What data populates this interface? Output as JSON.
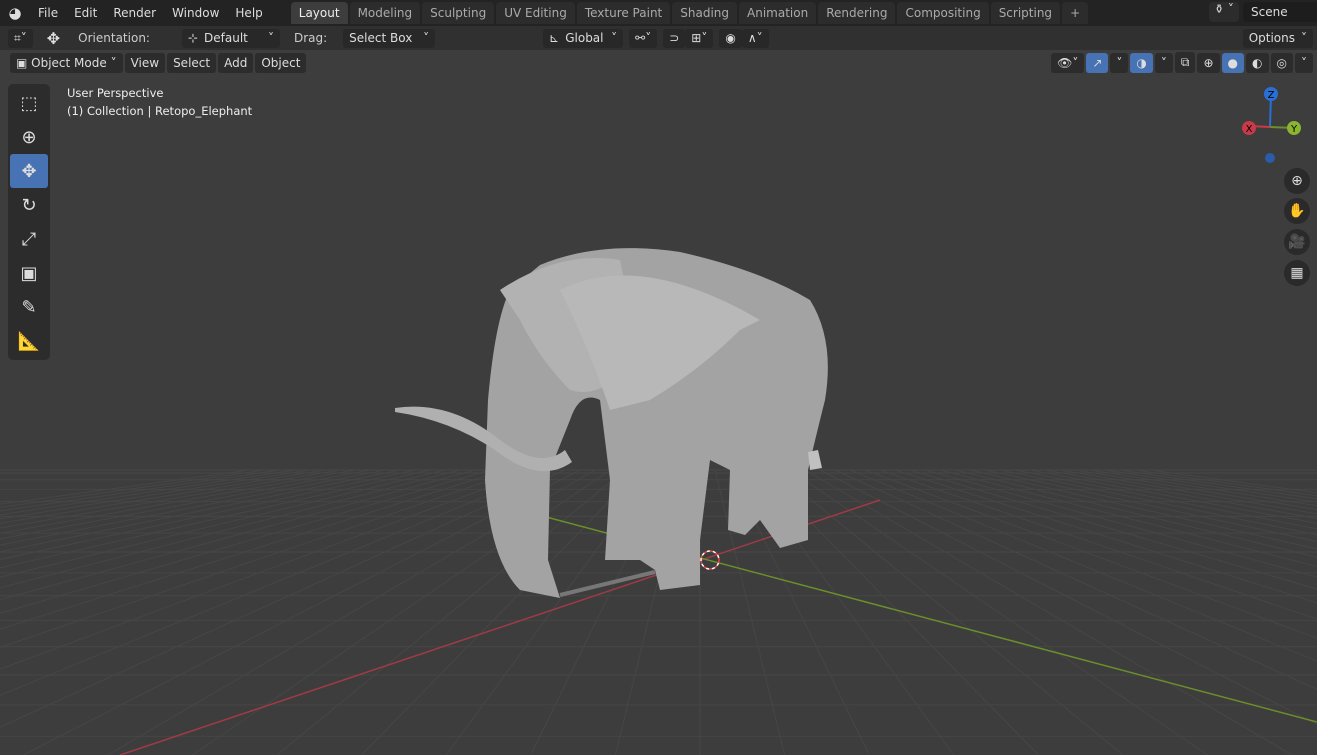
{
  "menu": [
    "File",
    "Edit",
    "Render",
    "Window",
    "Help"
  ],
  "workspaces": [
    {
      "label": "Layout",
      "active": true
    },
    {
      "label": "Modeling"
    },
    {
      "label": "Sculpting"
    },
    {
      "label": "UV Editing"
    },
    {
      "label": "Texture Paint"
    },
    {
      "label": "Shading"
    },
    {
      "label": "Animation"
    },
    {
      "label": "Rendering"
    },
    {
      "label": "Compositing"
    },
    {
      "label": "Scripting"
    }
  ],
  "add_workspace": "+",
  "scene": "Scene",
  "tool_header": {
    "orientation_label": "Orientation:",
    "orientation_value": "Default",
    "drag_label": "Drag:",
    "drag_value": "Select Box",
    "transform_orientation": "Global",
    "options": "Options"
  },
  "viewport_header": {
    "mode": "Object Mode",
    "menus": [
      "View",
      "Select",
      "Add",
      "Object"
    ]
  },
  "overlay": {
    "view": "User Perspective",
    "collection": "(1) Collection | Retopo_Elephant"
  },
  "gizmo": {
    "z": "Z",
    "y": "Y",
    "x": "X"
  },
  "colors": {
    "accent": "#4772b3",
    "x_axis": "#9e3b46",
    "y_axis": "#6b8f2a",
    "z_axis": "#2a6fd6"
  }
}
